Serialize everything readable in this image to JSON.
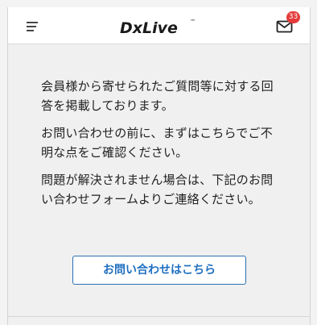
{
  "header": {
    "logo_text": "DxLive",
    "logo_mark": "™",
    "unread_count": "33"
  },
  "content": {
    "paragraphs": [
      "会員様から寄せられたご質問等に対する回答を掲載しております。",
      "お問い合わせの前に、まずはこちらでご不明な点をご確認ください。",
      "問題が解決されません場合は、下記のお問い合わせフォームよりご連絡ください。"
    ],
    "contact_button_label": "お問い合わせはこちら"
  },
  "colors": {
    "accent": "#1f6fc0",
    "badge": "#e53a3a",
    "background": "#f0f0f0"
  },
  "icons": {
    "menu": "menu-icon",
    "mail": "mail-icon"
  }
}
